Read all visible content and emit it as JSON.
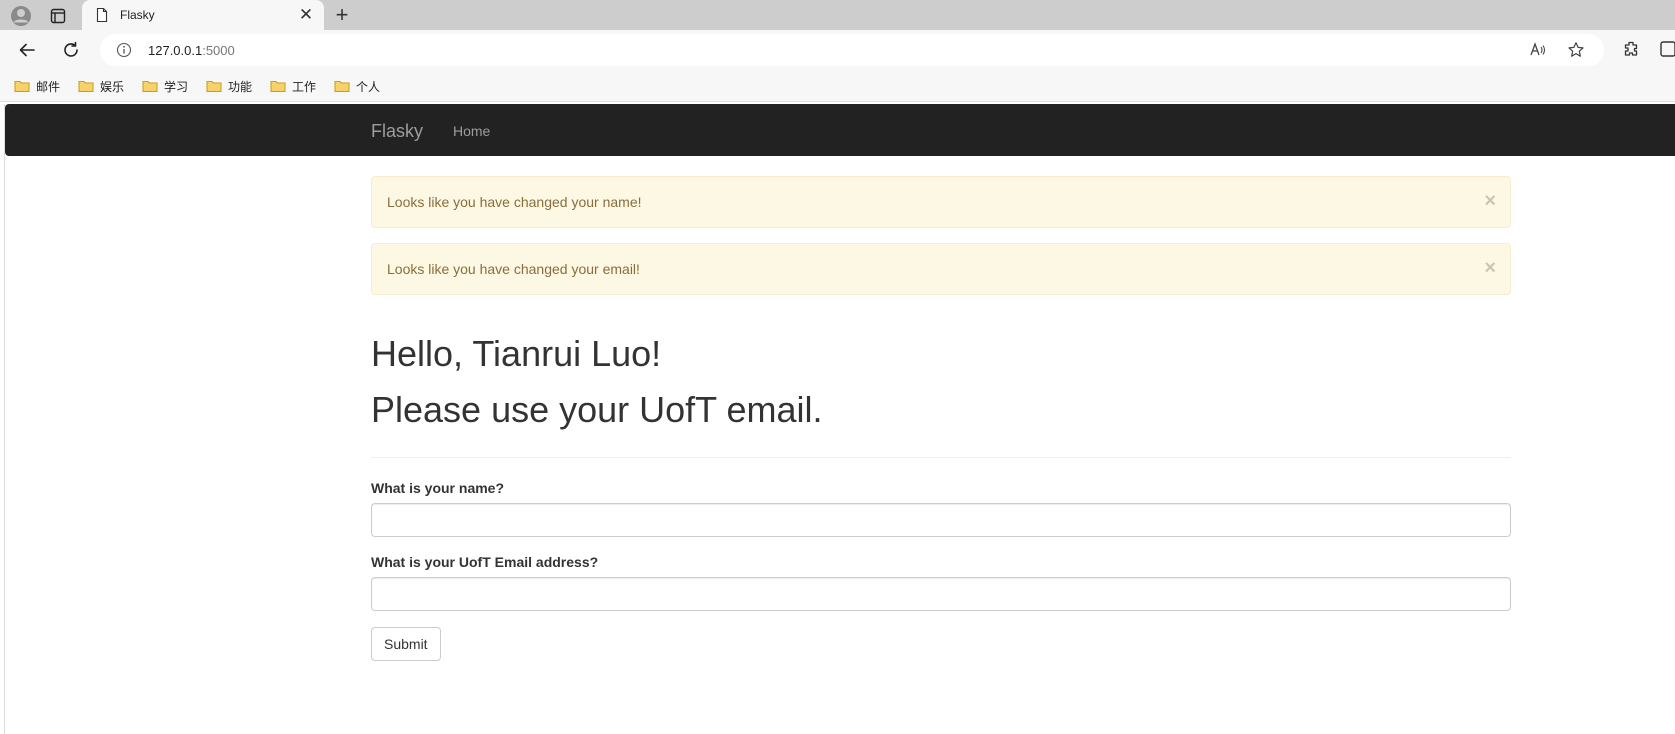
{
  "browser": {
    "tab": {
      "title": "Flasky",
      "icon": "page-icon"
    },
    "address_bar": {
      "host": "127.0.0.1",
      "port": ":5000"
    },
    "bookmarks": [
      "邮件",
      "娱乐",
      "学习",
      "功能",
      "工作",
      "个人"
    ]
  },
  "navbar": {
    "brand": "Flasky",
    "links": [
      "Home"
    ]
  },
  "alerts": [
    {
      "text": "Looks like you have changed your name!",
      "close": "×"
    },
    {
      "text": "Looks like you have changed your email!",
      "close": "×"
    }
  ],
  "headings": {
    "greeting": "Hello, Tianrui Luo!",
    "message": "Please use your UofT email."
  },
  "form": {
    "name_label": "What is your name?",
    "name_value": "",
    "email_label": "What is your UofT Email address?",
    "email_value": "",
    "submit_label": "Submit"
  },
  "colors": {
    "navbar_bg": "#222222",
    "alert_bg": "#fcf8e3",
    "alert_text": "#8a6d3b",
    "folder": "#f2c14e"
  }
}
